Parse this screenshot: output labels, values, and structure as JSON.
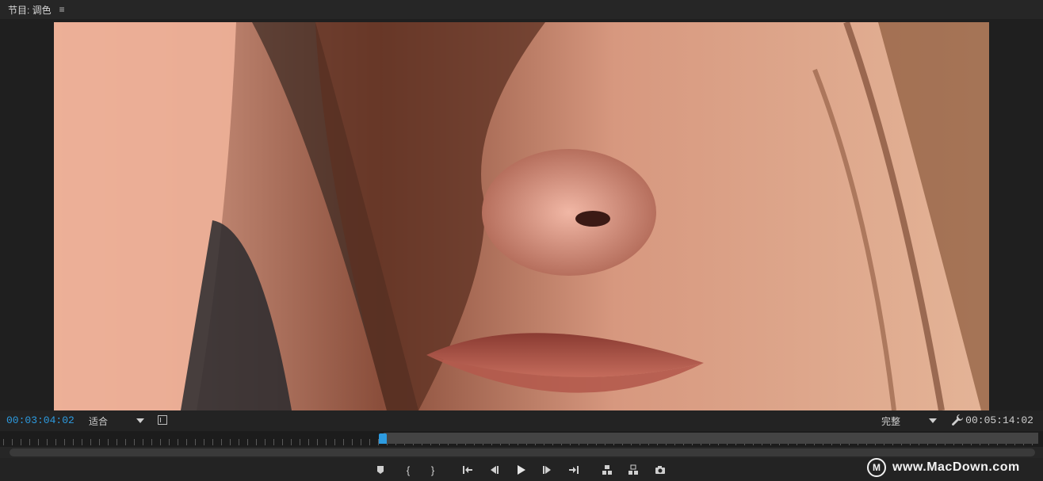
{
  "panel": {
    "title": "节目: 调色",
    "menu_icon": "hamburger-menu-icon"
  },
  "viewer": {
    "frame_description_icon": "video-frame"
  },
  "controls": {
    "current_timecode": "00:03:04:02",
    "zoom_label": "适合",
    "resolution_label": "完整",
    "duration_timecode": "00:05:14:02",
    "accent_color": "#2d9be0"
  },
  "transport": {
    "buttons": [
      {
        "name": "add-marker-button",
        "icon": "marker-icon"
      },
      {
        "name": "mark-in-button",
        "icon": "mark-in-icon"
      },
      {
        "name": "mark-out-button",
        "icon": "mark-out-icon"
      },
      {
        "name": "go-to-in-button",
        "icon": "go-to-in-icon"
      },
      {
        "name": "step-back-button",
        "icon": "step-back-icon"
      },
      {
        "name": "play-button",
        "icon": "play-icon"
      },
      {
        "name": "step-forward-button",
        "icon": "step-forward-icon"
      },
      {
        "name": "go-to-out-button",
        "icon": "go-to-out-icon"
      },
      {
        "name": "lift-button",
        "icon": "lift-icon"
      },
      {
        "name": "extract-button",
        "icon": "extract-icon"
      },
      {
        "name": "export-frame-button",
        "icon": "camera-icon"
      }
    ]
  },
  "watermark": {
    "logo_text": "M",
    "text": "www.MacDown.com"
  }
}
